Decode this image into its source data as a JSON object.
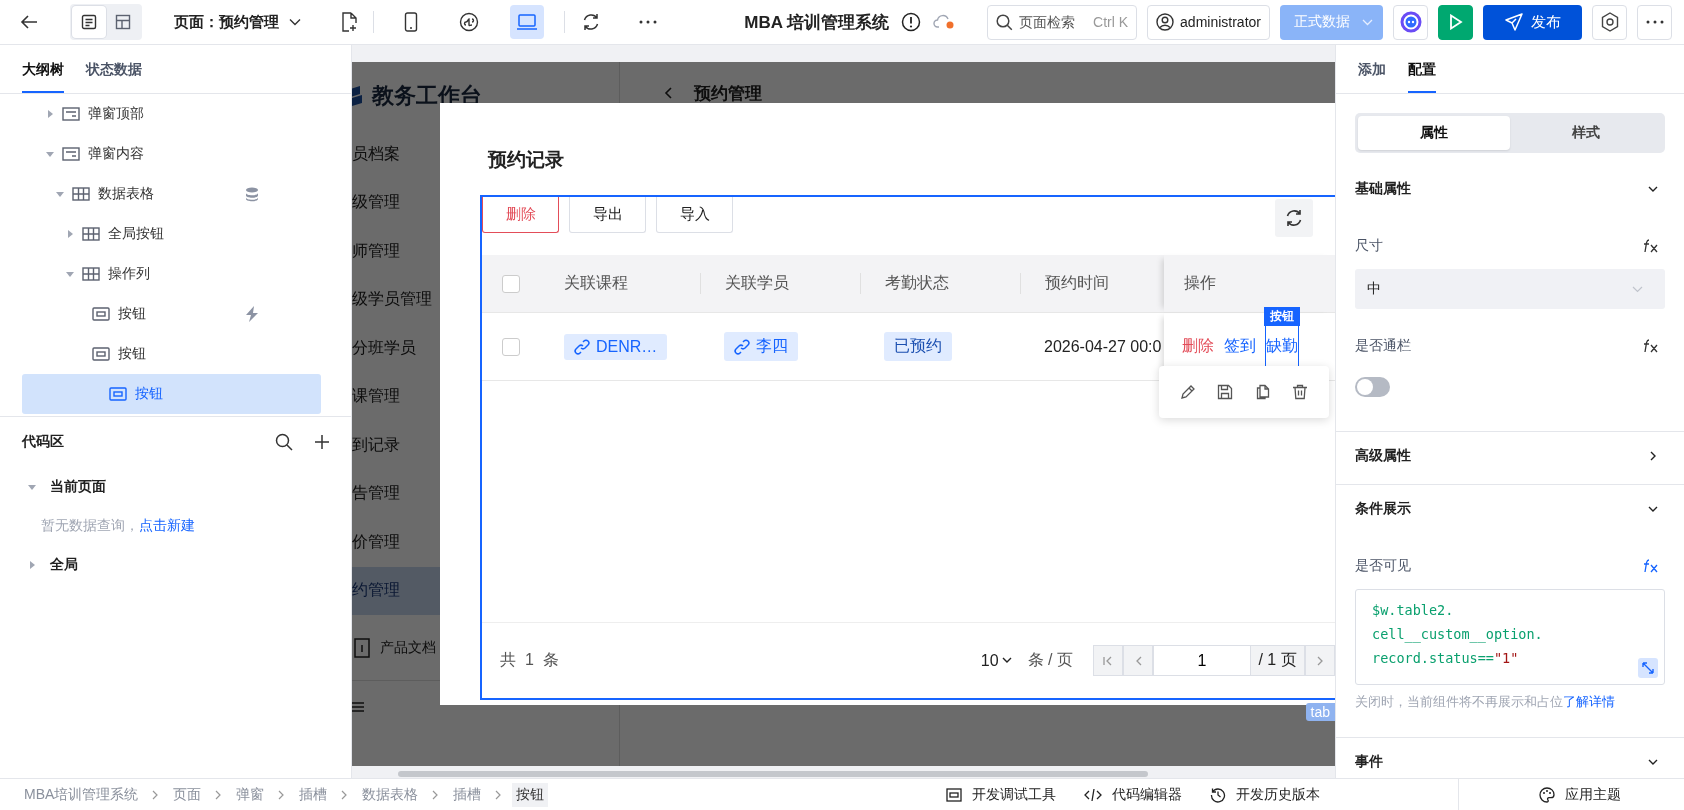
{
  "toolbar": {
    "view_modes": [
      {
        "kind": "page",
        "selected": true
      },
      {
        "kind": "layout",
        "selected": false
      }
    ],
    "page_selector": "页面：预约管理",
    "devices": [
      {
        "kind": "mobile",
        "selected": false
      },
      {
        "kind": "miniprogram",
        "selected": false
      },
      {
        "kind": "desktop",
        "selected": true
      }
    ],
    "app_title": "MBA 培训管理系统",
    "search": {
      "placeholder": "页面检索",
      "shortcut": "Ctrl K"
    },
    "user": "administrator",
    "environment": "正式数据",
    "publish": "发布"
  },
  "left_panel": {
    "tabs": [
      {
        "label": "大纲树",
        "selected": true
      },
      {
        "label": "状态数据",
        "selected": false
      }
    ],
    "tree": [
      {
        "label": "弹窗顶部",
        "kind": "container",
        "expanded": false,
        "selected": false,
        "data_bound": false,
        "has_event": false
      },
      {
        "label": "弹窗内容",
        "kind": "container",
        "expanded": true,
        "selected": false,
        "data_bound": false,
        "has_event": false,
        "children": [
          {
            "label": "数据表格",
            "kind": "table",
            "expanded": true,
            "selected": false,
            "data_bound": true,
            "has_event": false,
            "children": [
              {
                "label": "全局按钮",
                "kind": "table",
                "expanded": false,
                "selected": false,
                "data_bound": false,
                "has_event": false
              },
              {
                "label": "操作列",
                "kind": "table",
                "expanded": true,
                "selected": false,
                "data_bound": false,
                "has_event": false,
                "children": [
                  {
                    "label": "按钮",
                    "kind": "button",
                    "selected": false,
                    "data_bound": false,
                    "has_event": true
                  },
                  {
                    "label": "按钮",
                    "kind": "button",
                    "selected": false,
                    "data_bound": false,
                    "has_event": false
                  },
                  {
                    "label": "按钮",
                    "kind": "button",
                    "selected": true,
                    "data_bound": false,
                    "has_event": false
                  }
                ]
              }
            ]
          }
        ]
      }
    ],
    "code_area": {
      "title": "代码区",
      "groups": [
        {
          "label": "当前页面",
          "expanded": true,
          "empty_text": "暂无数据查询，",
          "link": "点击新建"
        },
        {
          "label": "全局",
          "expanded": false
        }
      ]
    }
  },
  "canvas": {
    "preview": {
      "brand": "教务工作台",
      "page_title": "预约管理",
      "menu": [
        {
          "label": "员档案",
          "selected": false
        },
        {
          "label": "级管理",
          "selected": false
        },
        {
          "label": "师管理",
          "selected": false
        },
        {
          "label": "级学员管理",
          "selected": false
        },
        {
          "label": "分班学员",
          "selected": false
        },
        {
          "label": "课管理",
          "selected": false
        },
        {
          "label": "到记录",
          "selected": false
        },
        {
          "label": "告管理",
          "selected": false
        },
        {
          "label": "价管理",
          "selected": false
        },
        {
          "label": "约管理",
          "selected": true
        }
      ],
      "docs": "产品文档"
    },
    "modal": {
      "title": "预约记录",
      "actions": [
        {
          "label": "删除",
          "kind": "danger"
        },
        {
          "label": "导出",
          "kind": "default"
        },
        {
          "label": "导入",
          "kind": "default"
        }
      ],
      "all_checked": false,
      "columns": [
        "关联课程",
        "关联学员",
        "考勤状态",
        "预约时间",
        "操作"
      ],
      "rows": [
        {
          "checked": false,
          "course": "DENR…",
          "student": "李四",
          "status": "已预约",
          "time": "2026-04-27 00:0",
          "operations": [
            {
              "label": "删除",
              "kind": "danger",
              "selected": false
            },
            {
              "label": "签到",
              "kind": "link",
              "selected": false
            },
            {
              "label": "缺勤",
              "kind": "link",
              "selected": true
            }
          ]
        }
      ],
      "selection_badge": "按钮",
      "total": {
        "prefix": "共",
        "count": "1",
        "suffix": "条"
      },
      "page_size": "10",
      "page_size_unit": "条 / 页",
      "current_page": "1",
      "page_total": "/ 1 页",
      "component_tag": "tab"
    }
  },
  "right_panel": {
    "tabs": [
      {
        "label": "添加",
        "selected": false
      },
      {
        "label": "配置",
        "selected": true
      }
    ],
    "modes": [
      {
        "label": "属性",
        "selected": true
      },
      {
        "label": "样式",
        "selected": false
      }
    ],
    "sections": [
      {
        "title": "基础属性",
        "expanded": true,
        "fields": [
          {
            "kind": "select",
            "label": "尺寸",
            "value": "中",
            "bound": false
          },
          {
            "kind": "switch",
            "label": "是否通栏",
            "on": false,
            "bound": false
          }
        ]
      },
      {
        "title": "高级属性",
        "expanded": false
      },
      {
        "title": "条件展示",
        "expanded": true,
        "fields": [
          {
            "kind": "code",
            "label": "是否可见",
            "bound": true,
            "lines": [
              [
                {
                  "text": "$w.table2.",
                  "kind": "code"
                }
              ],
              [
                {
                  "text": "cell__custom__option.",
                  "kind": "code"
                }
              ],
              [
                {
                  "text": "record.status==",
                  "kind": "code"
                },
                {
                  "text": "\"1\"",
                  "kind": "string"
                }
              ]
            ],
            "hint": "关闭时，当前组件将不再展示和占位",
            "link": "了解详情"
          }
        ]
      },
      {
        "title": "事件",
        "expanded": true
      }
    ]
  },
  "status_bar": {
    "breadcrumb": [
      {
        "label": "MBA培训管理系统",
        "selected": false
      },
      {
        "label": "页面",
        "selected": false
      },
      {
        "label": "弹窗",
        "selected": false
      },
      {
        "label": "插槽",
        "selected": false
      },
      {
        "label": "数据表格",
        "selected": false
      },
      {
        "label": "插槽",
        "selected": false
      },
      {
        "label": "按钮",
        "selected": true
      }
    ],
    "tools": [
      {
        "kind": "debug",
        "label": "开发调试工具"
      },
      {
        "kind": "code",
        "label": "代码编辑器"
      },
      {
        "kind": "history",
        "label": "开发历史版本"
      },
      {
        "kind": "theme",
        "label": "应用主题"
      }
    ]
  }
}
